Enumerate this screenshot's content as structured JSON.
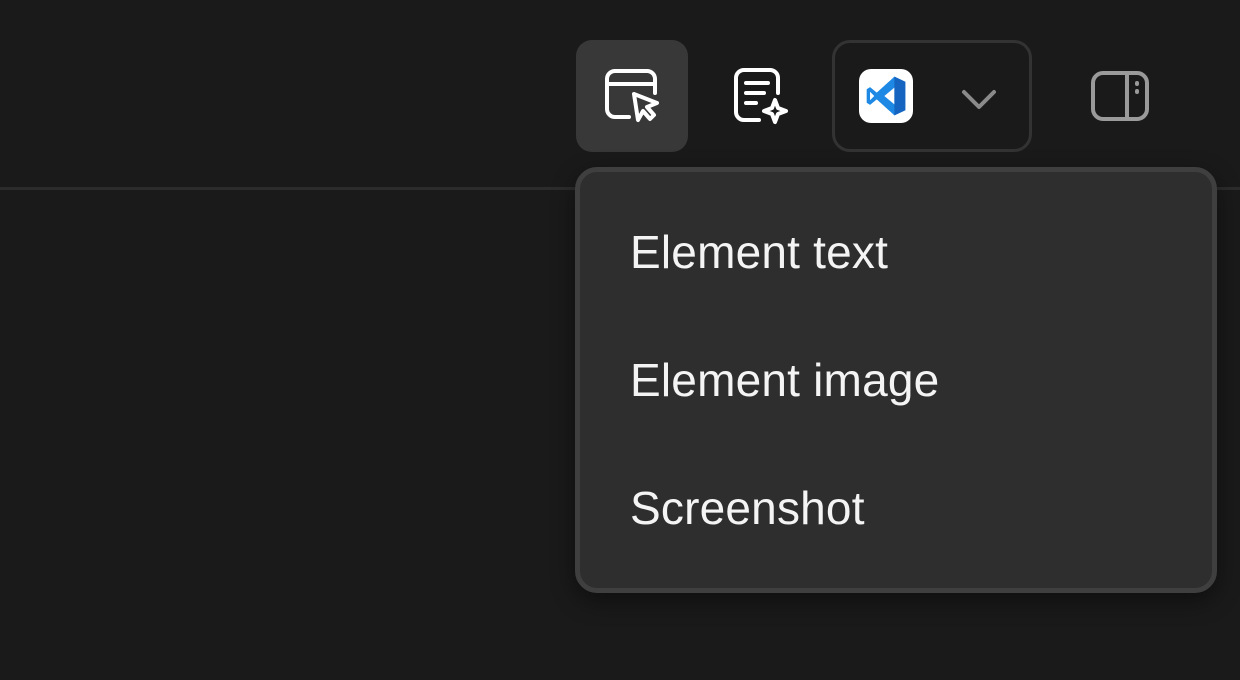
{
  "toolbar": {
    "inspect_icon": "element-select-icon",
    "notes_icon": "ai-notes-icon",
    "editor_icon": "vscode-icon",
    "editor_dropdown_icon": "chevron-down-icon",
    "panel_icon": "sidebar-toggle-icon"
  },
  "menu": {
    "items": [
      {
        "label": "Element text"
      },
      {
        "label": "Element image"
      },
      {
        "label": "Screenshot"
      }
    ]
  },
  "colors": {
    "background": "#1a1a1a",
    "active_button": "#383838",
    "menu_background": "#2e2e2e",
    "menu_border": "#3f3f3f",
    "vscode_blue": "#1e88e5"
  }
}
